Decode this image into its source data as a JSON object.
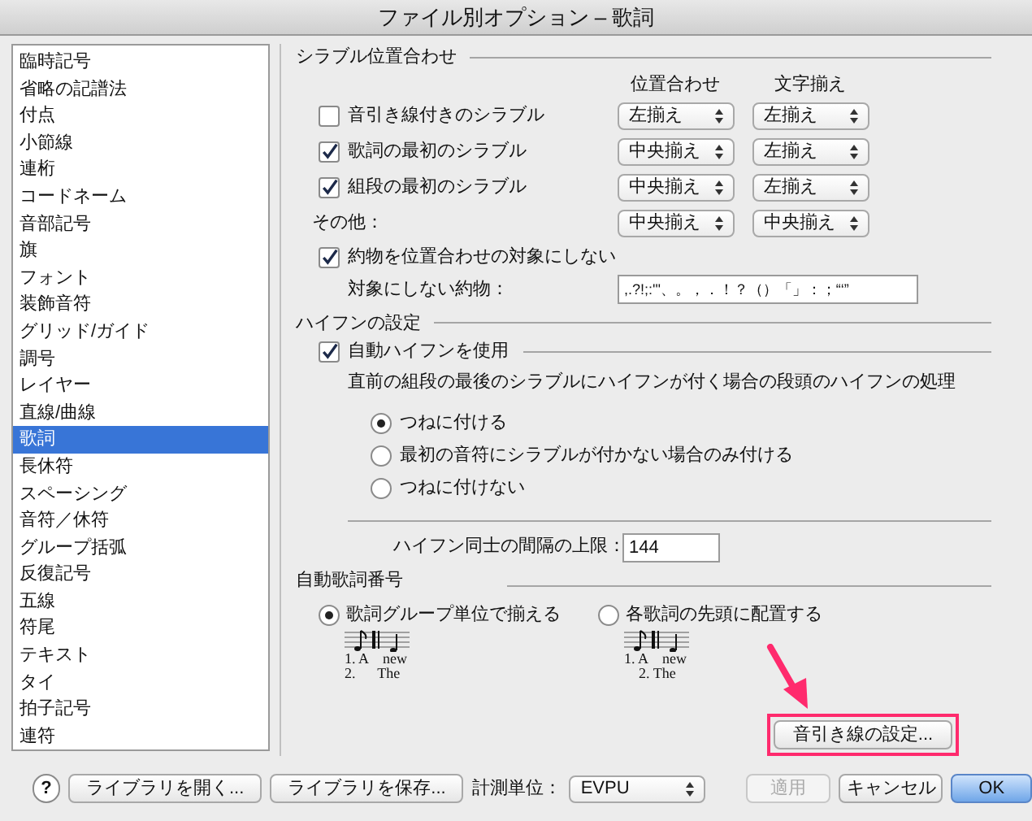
{
  "window": {
    "title": "ファイル別オプション – 歌詞"
  },
  "sidebar": {
    "items": [
      {
        "label": "臨時記号",
        "selected": false
      },
      {
        "label": "省略の記譜法",
        "selected": false
      },
      {
        "label": "付点",
        "selected": false
      },
      {
        "label": "小節線",
        "selected": false
      },
      {
        "label": "連桁",
        "selected": false
      },
      {
        "label": "コードネーム",
        "selected": false
      },
      {
        "label": "音部記号",
        "selected": false
      },
      {
        "label": "旗",
        "selected": false
      },
      {
        "label": "フォント",
        "selected": false
      },
      {
        "label": "装飾音符",
        "selected": false
      },
      {
        "label": "グリッド/ガイド",
        "selected": false
      },
      {
        "label": "調号",
        "selected": false
      },
      {
        "label": "レイヤー",
        "selected": false
      },
      {
        "label": "直線/曲線",
        "selected": false
      },
      {
        "label": "歌詞",
        "selected": true
      },
      {
        "label": "長休符",
        "selected": false
      },
      {
        "label": "スペーシング",
        "selected": false
      },
      {
        "label": "音符／休符",
        "selected": false
      },
      {
        "label": "グループ括弧",
        "selected": false
      },
      {
        "label": "反復記号",
        "selected": false
      },
      {
        "label": "五線",
        "selected": false
      },
      {
        "label": "符尾",
        "selected": false
      },
      {
        "label": "テキスト",
        "selected": false
      },
      {
        "label": "タイ",
        "selected": false
      },
      {
        "label": "拍子記号",
        "selected": false
      },
      {
        "label": "連符",
        "selected": false
      }
    ]
  },
  "syllable_alignment": {
    "title": "シラブル位置合わせ",
    "column_headers": [
      "位置合わせ",
      "文字揃え"
    ],
    "rows": [
      {
        "kind": "checkbox",
        "label": "音引き線付きのシラブル",
        "checked": false,
        "alignment": "左揃え",
        "justification": "左揃え"
      },
      {
        "kind": "checkbox",
        "label": "歌詞の最初のシラブル",
        "checked": true,
        "alignment": "中央揃え",
        "justification": "左揃え"
      },
      {
        "kind": "checkbox",
        "label": "組段の最初のシラブル",
        "checked": true,
        "alignment": "中央揃え",
        "justification": "左揃え"
      },
      {
        "kind": "label",
        "label": "その他：",
        "alignment": "中央揃え",
        "justification": "中央揃え"
      }
    ],
    "ignore_punctuation": {
      "label": "約物を位置合わせの対象にしない",
      "checked": true
    },
    "ignored_punctuation": {
      "label": "対象にしない約物：",
      "value": ",.?!;:'\"、。，．！？（）「」：；“‘”"
    }
  },
  "hyphens": {
    "title": "ハイフンの設定",
    "auto_hyphen": {
      "label": "自動ハイフンを使用",
      "checked": true
    },
    "description": "直前の組段の最後のシラブルにハイフンが付く場合の段頭のハイフンの処理",
    "options": [
      {
        "label": "つねに付ける",
        "selected": true
      },
      {
        "label": "最初の音符にシラブルが付かない場合のみ付ける",
        "selected": false
      },
      {
        "label": "つねに付けない",
        "selected": false
      }
    ],
    "max_gap": {
      "label": "ハイフン同士の間隔の上限：",
      "value": "144"
    }
  },
  "auto_lyric_numbering": {
    "title": "自動歌詞番号",
    "options": [
      {
        "label": "歌詞グループ単位で揃える",
        "selected": true,
        "example": [
          "1. A    new",
          "2.      The"
        ]
      },
      {
        "label": "各歌詞の先頭に配置する",
        "selected": false,
        "example": [
          "1. A    new",
          "    2. The"
        ]
      }
    ]
  },
  "word_extension_button": "音引き線の設定...",
  "footer": {
    "help": "?",
    "open_library": "ライブラリを開く...",
    "save_library": "ライブラリを保存...",
    "units_label": "計測単位：",
    "units": "EVPU",
    "apply": "適用",
    "cancel": "キャンセル",
    "ok": "OK"
  }
}
